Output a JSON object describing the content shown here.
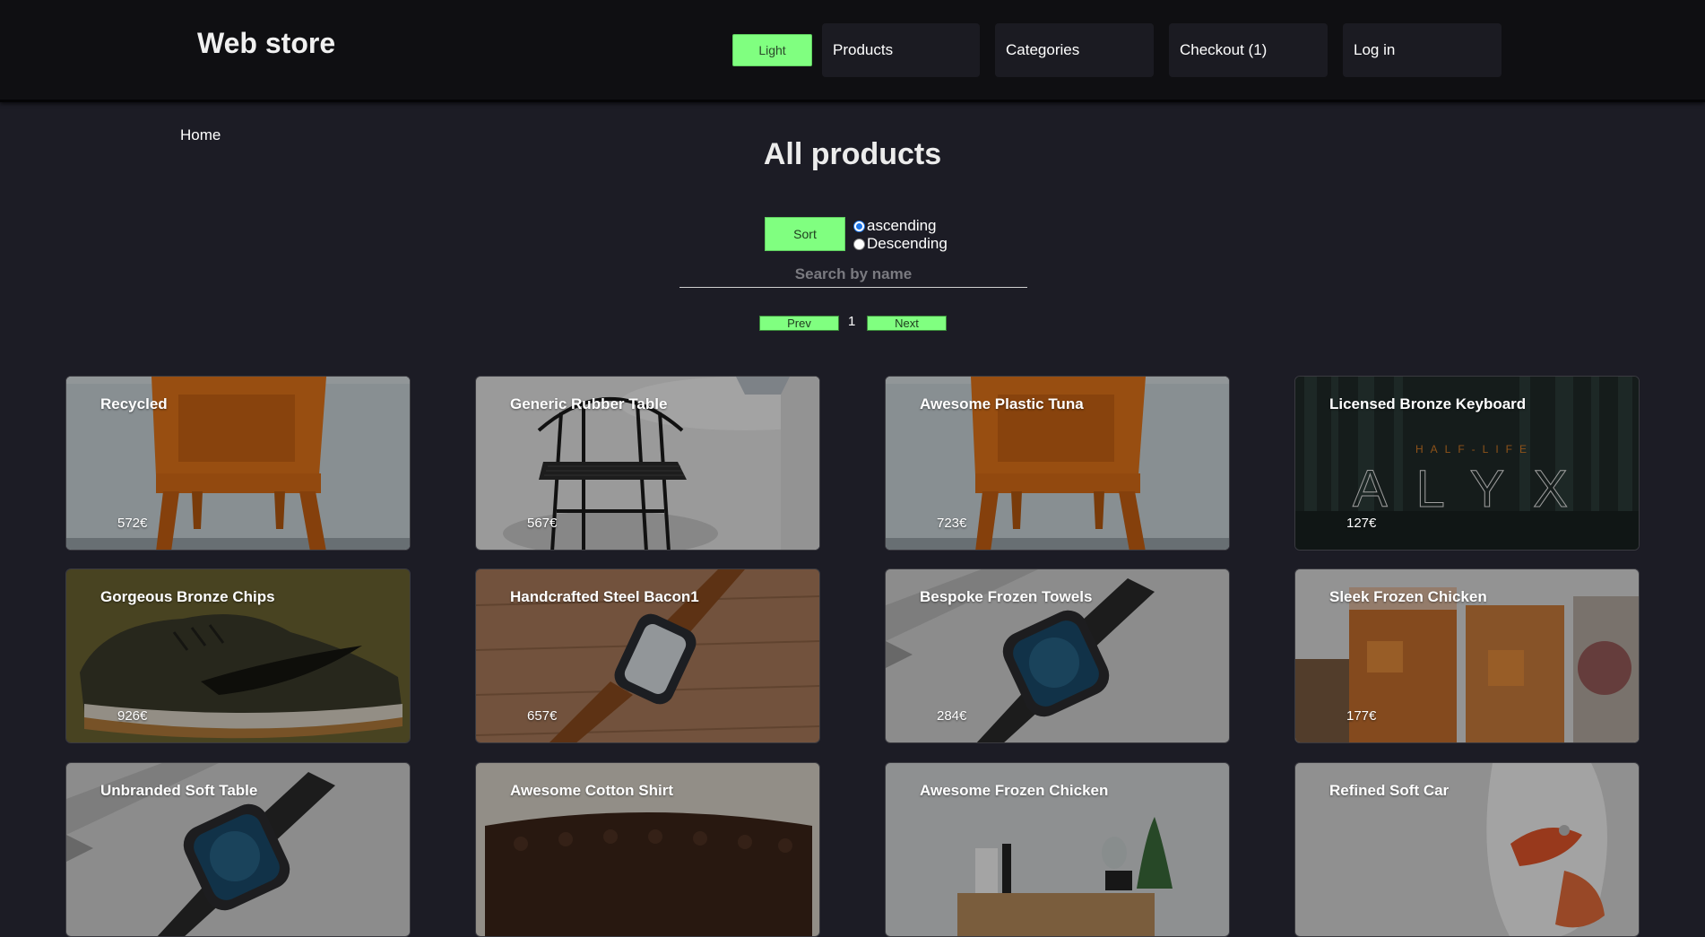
{
  "header": {
    "logo": "Web store",
    "theme_label": "Light",
    "nav": [
      {
        "label": "Products"
      },
      {
        "label": "Categories"
      },
      {
        "label": "Checkout (1)"
      },
      {
        "label": "Log in"
      }
    ]
  },
  "breadcrumb": "Home",
  "page_title": "All products",
  "controls": {
    "sort_label": "Sort",
    "ascending_label": "ascending",
    "descending_label": "Descending",
    "selected_order": "ascending",
    "search_placeholder": "Search by name",
    "prev_label": "Prev",
    "next_label": "Next",
    "page": "1"
  },
  "colors": {
    "accent": "#80ff80",
    "background": "#1c1c25",
    "header": "#0f0f12"
  },
  "products": [
    {
      "name": "Recycled",
      "price": "572€",
      "image": "orange-chair"
    },
    {
      "name": "Generic Rubber Table",
      "price": "567€",
      "image": "black-chair"
    },
    {
      "name": "Awesome Plastic Tuna",
      "price": "723€",
      "image": "orange-chair"
    },
    {
      "name": "Licensed Bronze Keyboard",
      "price": "127€",
      "image": "half-life-alyx"
    },
    {
      "name": "Gorgeous Bronze Chips",
      "price": "926€",
      "image": "sneaker"
    },
    {
      "name": "Handcrafted Steel Bacon1",
      "price": "657€",
      "image": "brown-watch"
    },
    {
      "name": "Bespoke Frozen Towels",
      "price": "284€",
      "image": "smart-watch"
    },
    {
      "name": "Sleek Frozen Chicken",
      "price": "177€",
      "image": "drinks"
    },
    {
      "name": "Unbranded Soft Table",
      "price": "",
      "image": "smart-watch"
    },
    {
      "name": "Awesome Cotton Shirt",
      "price": "",
      "image": "sofa"
    },
    {
      "name": "Awesome Frozen Chicken",
      "price": "",
      "image": "cabinet"
    },
    {
      "name": "Refined Soft Car",
      "price": "",
      "image": "white-sneaker"
    }
  ],
  "logo_art": {
    "half_life": "HALF-LIFE",
    "alyx": "ALYX"
  }
}
